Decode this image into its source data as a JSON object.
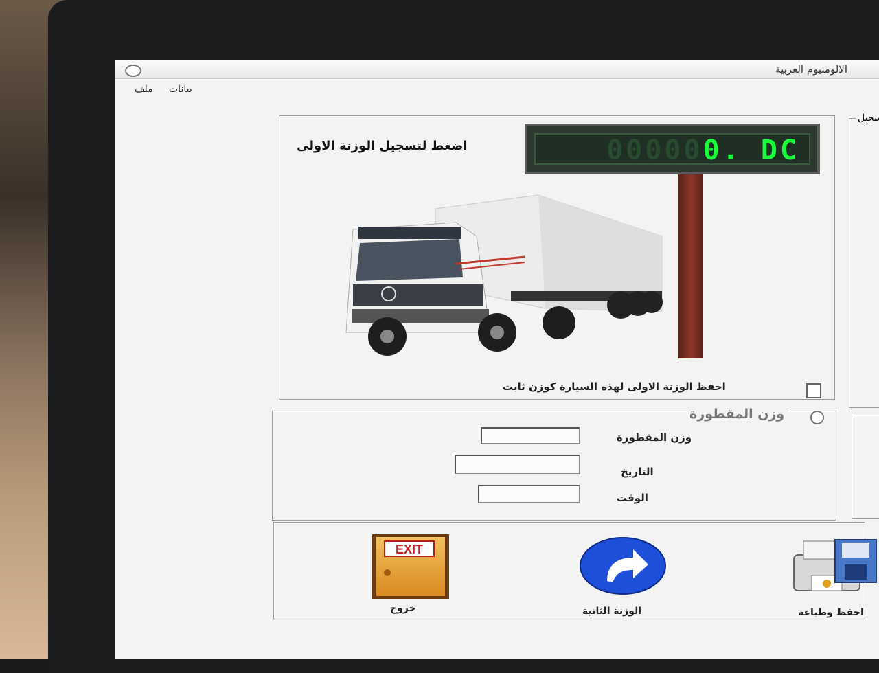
{
  "window": {
    "title": "الالومنيوم العربية"
  },
  "menu": [
    "ملف",
    "بيانات"
  ],
  "main": {
    "prompt": "اضغط لتسجيل الوزنة الاولى",
    "display": {
      "ghost": "00000",
      "value": "0. DC"
    },
    "fixed_weight_checkbox": {
      "label": "احفظ الوزنة الاولى لهذه السيارة كوزن ثابت",
      "checked": false
    },
    "side_label": "سجيل"
  },
  "tare": {
    "legend": "وزن المقطورة",
    "fields": [
      {
        "label": "وزن المقطورة",
        "value": ""
      },
      {
        "label": "التاريخ",
        "value": ""
      },
      {
        "label": "الوقت",
        "value": ""
      }
    ]
  },
  "buttons": {
    "exit": {
      "label": "خروج",
      "sign": "EXIT"
    },
    "second_weight": {
      "label": "الوزنة الثانية"
    },
    "save_print": {
      "label": "احفظ وطباعة"
    }
  }
}
